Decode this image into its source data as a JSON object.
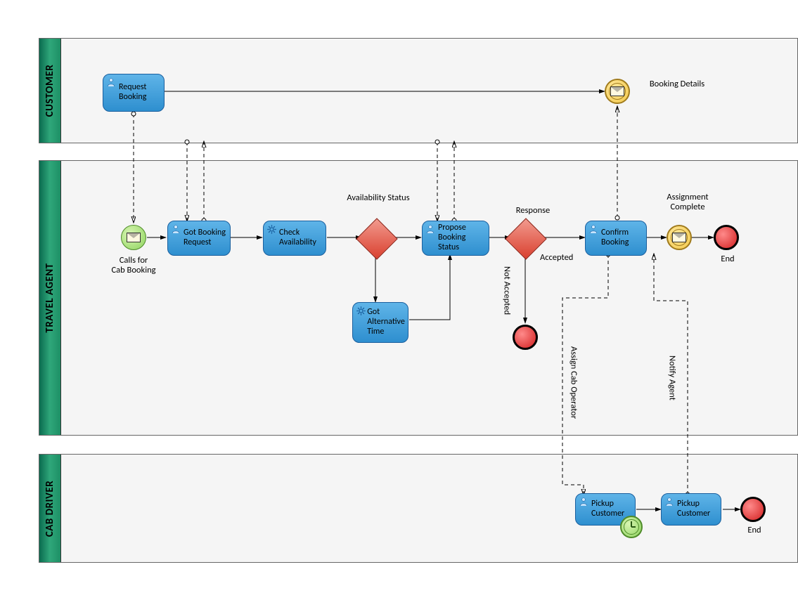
{
  "pools": {
    "customer": {
      "title": "CUSTOMER"
    },
    "agent": {
      "title": "TRAVEL AGENT"
    },
    "driver": {
      "title": "CAB DRIVER"
    }
  },
  "customer": {
    "request_booking": "Request Booking",
    "booking_details": "Booking Details"
  },
  "agent": {
    "calls_for": "Calls for\nCab Booking",
    "got_booking": "Got Booking Request",
    "check_avail": "Check Availability",
    "avail_status": "Availability Status",
    "propose": "Propose Booking Status",
    "got_alt": "Got Alternative Time",
    "response": "Response",
    "not_accepted": "Not Accepted",
    "accepted": "Accepted",
    "confirm": "Confirm Booking",
    "assign_complete": "Assignment Complete",
    "end": "End",
    "assign_cab": "Assign Cab Operator",
    "notify_agent": "Notify Agent"
  },
  "driver": {
    "pickup1": "Pickup Customer",
    "pickup2": "Pickup Customer",
    "end": "End"
  }
}
